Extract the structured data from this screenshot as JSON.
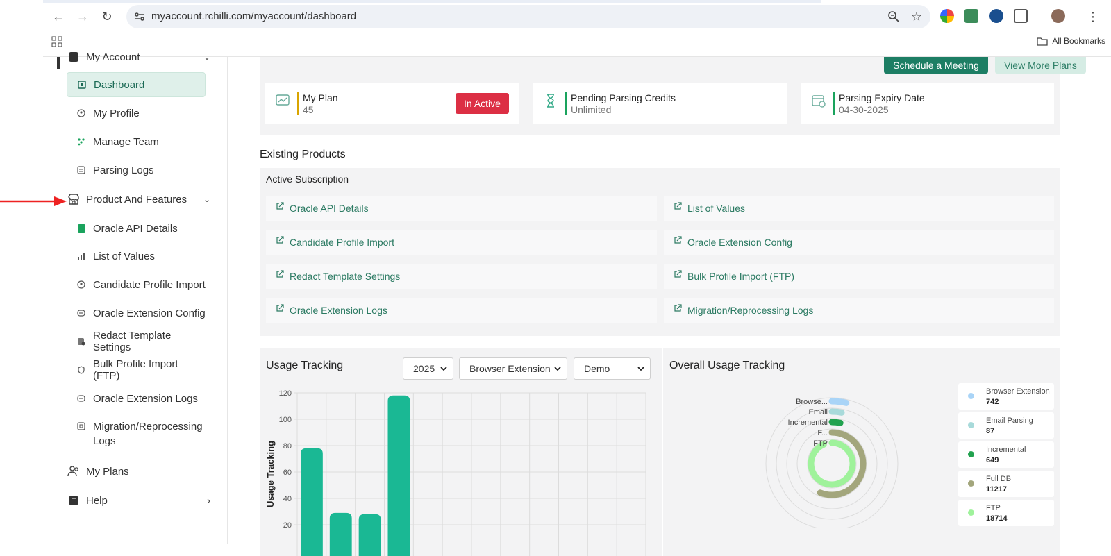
{
  "browser": {
    "url": "myaccount.rchilli.com/myaccount/dashboard",
    "bookmarks_label": "All Bookmarks"
  },
  "sidebar": {
    "partial_top_label": "My Account",
    "dashboard": "Dashboard",
    "my_profile": "My Profile",
    "manage_team": "Manage Team",
    "parsing_logs": "Parsing Logs",
    "product_features": "Product And Features",
    "sub_items": [
      "Oracle API Details",
      "List of Values",
      "Candidate Profile Import",
      "Oracle Extension Config",
      "Redact Template Settings",
      "Bulk Profile Import (FTP)",
      "Oracle Extension Logs",
      "Migration/Reprocessing Logs"
    ],
    "my_plans": "My Plans",
    "help": "Help"
  },
  "top": {
    "schedule_button": "Schedule a Meeting",
    "view_more_button": "View More Plans",
    "cards": [
      {
        "title": "My Plan",
        "value": "45",
        "badge": "In Active",
        "bar_color": "#d9a400"
      },
      {
        "title": "Pending Parsing Credits",
        "value": "Unlimited",
        "bar_color": "#1aa35d"
      },
      {
        "title": "Parsing Expiry Date",
        "value": "04-30-2025",
        "bar_color": "#1aa35d"
      }
    ]
  },
  "products": {
    "title": "Existing Products",
    "subtitle": "Active Subscription",
    "links": [
      "Oracle API Details",
      "List of Values",
      "Candidate Profile Import",
      "Oracle Extension Config",
      "Redact Template Settings",
      "Bulk Profile Import (FTP)",
      "Oracle Extension Logs",
      "Migration/Reprocessing Logs"
    ]
  },
  "usage": {
    "title": "Usage Tracking",
    "year": "2025",
    "source": "Browser Extension",
    "env": "Demo"
  },
  "overall": {
    "title": "Overall Usage Tracking"
  },
  "chart_data": [
    {
      "type": "bar",
      "ylabel": "Usage Tracking",
      "ylim": [
        0,
        120
      ],
      "yticks": [
        "20",
        "40",
        "60",
        "80",
        "100",
        "120"
      ],
      "values": [
        78,
        29,
        28,
        118
      ],
      "color": "#1ab894",
      "grid": true
    },
    {
      "type": "pie",
      "series": [
        {
          "name": "Browser Extension",
          "short": "Browse...",
          "value": 742,
          "color": "#a9d4f7"
        },
        {
          "name": "Email Parsing",
          "short": "Email",
          "value": 87,
          "color": "#a8dada"
        },
        {
          "name": "Incremental",
          "short": "Incremental",
          "value": 649,
          "color": "#22a24f"
        },
        {
          "name": "Full DB",
          "short": "F...",
          "value": 11217,
          "color": "#a3a67c"
        },
        {
          "name": "FTP",
          "short": "FTP",
          "value": 18714,
          "color": "#9ff29b"
        }
      ]
    }
  ]
}
